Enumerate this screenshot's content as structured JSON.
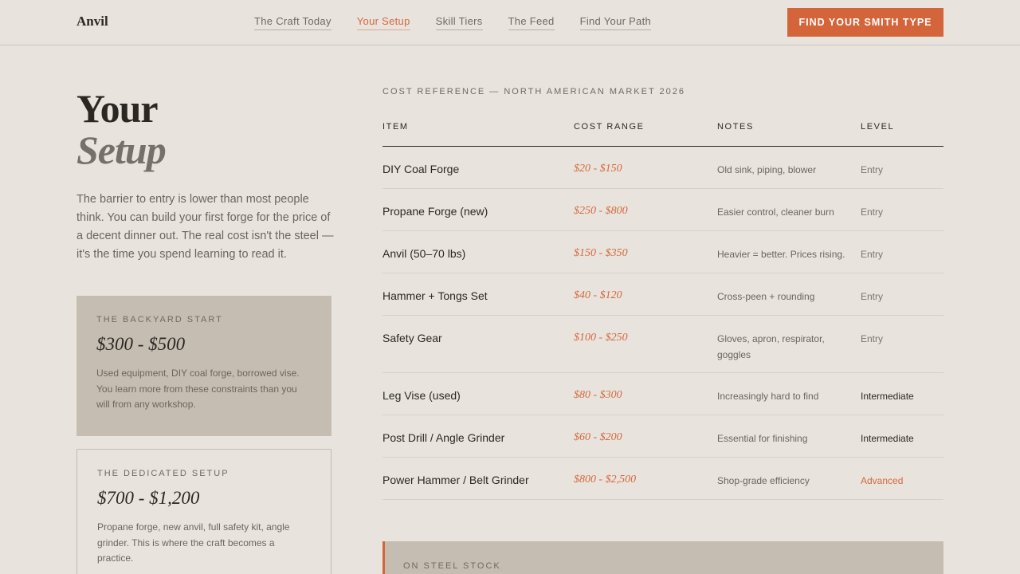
{
  "header": {
    "brand": "Anvil",
    "nav": [
      {
        "label": "The Craft Today",
        "active": false
      },
      {
        "label": "Your Setup",
        "active": true
      },
      {
        "label": "Skill Tiers",
        "active": false
      },
      {
        "label": "The Feed",
        "active": false
      },
      {
        "label": "Find Your Path",
        "active": false
      }
    ],
    "cta_label": "FIND YOUR SMITH TYPE"
  },
  "hero": {
    "title_line1": "Your",
    "title_line2": "Setup",
    "body": "The barrier to entry is lower than most people think. You can build your first forge for the price of a decent dinner out. The real cost isn't the steel — it's the time you spend learning to read it."
  },
  "setups": [
    {
      "label": "THE BACKYARD START",
      "price": "$300 - $500",
      "desc": "Used equipment, DIY coal forge, borrowed vise. You learn more from these constraints than you will from any workshop."
    },
    {
      "label": "THE DEDICATED SETUP",
      "price": "$700 - $1,200",
      "desc": "Propane forge, new anvil, full safety kit, angle grinder. This is where the craft becomes a practice."
    }
  ],
  "table": {
    "caption": "COST REFERENCE — NORTH AMERICAN MARKET 2026",
    "headers": [
      "ITEM",
      "COST RANGE",
      "NOTES",
      "LEVEL"
    ],
    "rows": [
      {
        "item": "DIY Coal Forge",
        "cost": "$20 - $150",
        "notes": "Old sink, piping, blower",
        "level": "Entry"
      },
      {
        "item": "Propane Forge (new)",
        "cost": "$250 - $800",
        "notes": "Easier control, cleaner burn",
        "level": "Entry"
      },
      {
        "item": "Anvil (50–70 lbs)",
        "cost": "$150 - $350",
        "notes": "Heavier = better. Prices rising.",
        "level": "Entry"
      },
      {
        "item": "Hammer + Tongs Set",
        "cost": "$40 - $120",
        "notes": "Cross-peen + rounding",
        "level": "Entry"
      },
      {
        "item": "Safety Gear",
        "cost": "$100 - $250",
        "notes": "Gloves, apron, respirator, goggles",
        "level": "Entry"
      },
      {
        "item": "Leg Vise (used)",
        "cost": "$80 - $300",
        "notes": "Increasingly hard to find",
        "level": "Intermediate"
      },
      {
        "item": "Post Drill / Angle Grinder",
        "cost": "$60 - $200",
        "notes": "Essential for finishing",
        "level": "Intermediate"
      },
      {
        "item": "Power Hammer / Belt Grinder",
        "cost": "$800 - $2,500",
        "notes": "Shop-grade efficiency",
        "level": "Advanced"
      }
    ]
  },
  "steel": {
    "label": "ON STEEL STOCK"
  },
  "colors": {
    "background": "#e8e4dd",
    "accent": "#d4653a",
    "card_fill": "#c6bdb2",
    "text": "#2b2723",
    "muted_text": "#6b655e"
  }
}
